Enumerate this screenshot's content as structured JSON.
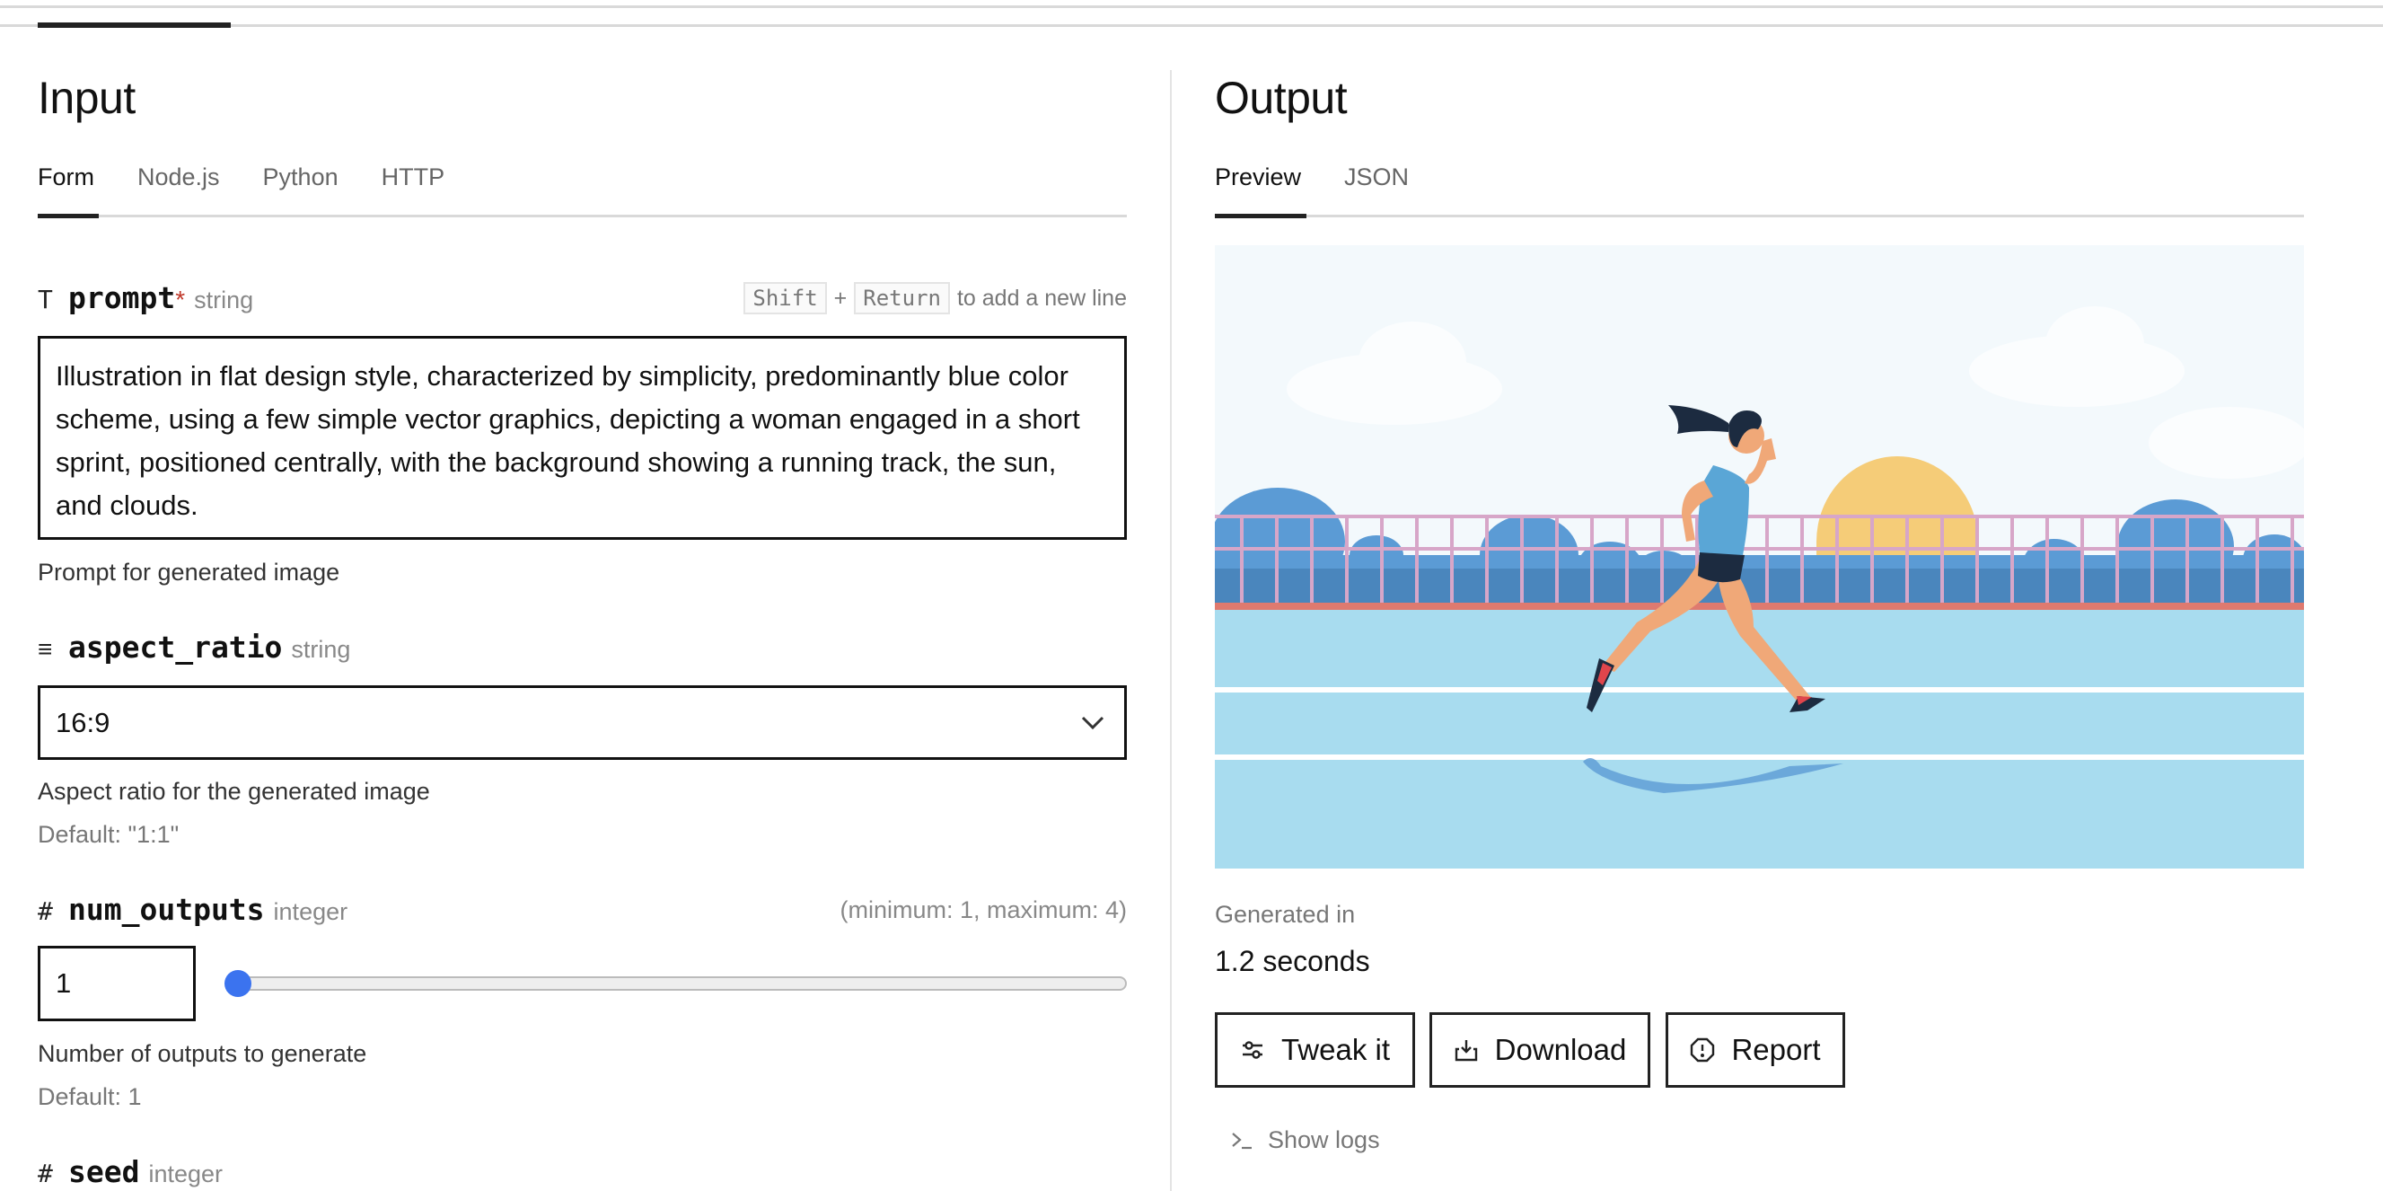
{
  "input": {
    "title": "Input",
    "tabs": [
      {
        "label": "Form",
        "active": true
      },
      {
        "label": "Node.js",
        "active": false
      },
      {
        "label": "Python",
        "active": false
      },
      {
        "label": "HTTP",
        "active": false
      }
    ],
    "fields": {
      "prompt": {
        "icon": "text-icon",
        "icon_glyph": "T",
        "name": "prompt",
        "required_mark": "*",
        "type": "string",
        "hint_key1": "Shift",
        "hint_plus": "+",
        "hint_key2": "Return",
        "hint_text": "to add a new line",
        "value": "Illustration in flat design style, characterized by simplicity, predominantly blue color scheme, using a few simple vector graphics, depicting a woman engaged in a short sprint, positioned centrally, with the background showing a running track, the sun, and clouds.",
        "description": "Prompt for generated image"
      },
      "aspect_ratio": {
        "icon": "list-icon",
        "icon_glyph": "≡",
        "name": "aspect_ratio",
        "type": "string",
        "value": "16:9",
        "description": "Aspect ratio for the generated image",
        "default": "Default: \"1:1\""
      },
      "num_outputs": {
        "icon": "hash-icon",
        "icon_glyph": "#",
        "name": "num_outputs",
        "type": "integer",
        "range_text": "(minimum: 1, maximum: 4)",
        "value": "1",
        "min": 1,
        "max": 4,
        "description": "Number of outputs to generate",
        "default": "Default: 1"
      },
      "seed": {
        "icon": "hash-icon",
        "icon_glyph": "#",
        "name": "seed",
        "type": "integer"
      }
    }
  },
  "output": {
    "title": "Output",
    "tabs": [
      {
        "label": "Preview",
        "active": true
      },
      {
        "label": "JSON",
        "active": false
      }
    ],
    "image_alt": "Flat design illustration of a woman sprinting on a blue running track with sun, clouds and trees behind a fence",
    "generated_label": "Generated in",
    "generated_value": "1.2 seconds",
    "buttons": {
      "tweak": "Tweak it",
      "download": "Download",
      "report": "Report"
    },
    "show_logs": "Show logs"
  },
  "colors": {
    "accent": "#3b73ef",
    "required": "#c0392b",
    "sky": "#f3f9fc",
    "track": "#a8dcef",
    "trees": "#5b9bd5",
    "sun": "#f5cc78",
    "fence": "#d7a6c8"
  }
}
